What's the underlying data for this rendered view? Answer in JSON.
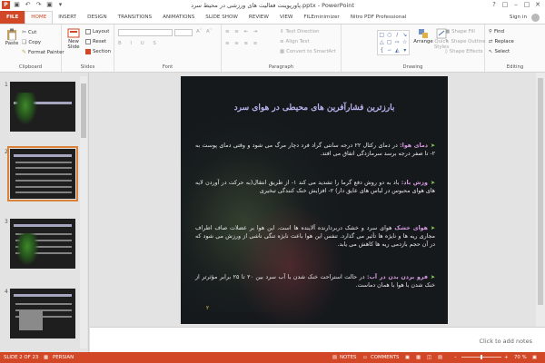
{
  "window": {
    "title": "پاورپوینت فعالیت های ورزشی در محیط سرد.pptx - PowerPoint",
    "sign_in": "Sign in"
  },
  "tabs": [
    {
      "label": "FILE"
    },
    {
      "label": "HOME"
    },
    {
      "label": "INSERT"
    },
    {
      "label": "DESIGN"
    },
    {
      "label": "TRANSITIONS"
    },
    {
      "label": "ANIMATIONS"
    },
    {
      "label": "SLIDE SHOW"
    },
    {
      "label": "REVIEW"
    },
    {
      "label": "VIEW"
    },
    {
      "label": "FILEminimizer"
    },
    {
      "label": "Nitro PDF Professional"
    }
  ],
  "ribbon": {
    "clipboard": {
      "label": "Clipboard",
      "paste": "Paste",
      "cut": "Cut",
      "copy": "Copy",
      "format_painter": "Format Painter"
    },
    "slides": {
      "label": "Slides",
      "new_slide": "New Slide",
      "layout": "Layout",
      "reset": "Reset",
      "section": "Section"
    },
    "font": {
      "label": "Font"
    },
    "paragraph": {
      "label": "Paragraph",
      "text_direction": "Text Direction",
      "align_text": "Align Text",
      "convert_smartart": "Convert to SmartArt"
    },
    "drawing": {
      "label": "Drawing",
      "arrange": "Arrange",
      "quick_styles": "Quick Styles",
      "shape_fill": "Shape Fill",
      "shape_outline": "Shape Outline",
      "shape_effects": "Shape Effects"
    },
    "editing": {
      "label": "Editing",
      "find": "Find",
      "replace": "Replace",
      "select": "Select"
    }
  },
  "thumbnails": [
    {
      "num": "1"
    },
    {
      "num": "2"
    },
    {
      "num": "3"
    },
    {
      "num": "4"
    }
  ],
  "slide": {
    "title": "بارزترین فشارآفرین های محیطی در هوای سرد",
    "paragraphs": [
      {
        "key": "دمای هوا:",
        "text": " در دمای رکتال ۲۲ درجه سانتی گراد فرد دچار مرگ می شود و وقتی دمای پوست به ۲- تا صفر درجه برسد سرمازدگی اتفاق می افتد."
      },
      {
        "key": "وزش باد:",
        "text": " باد به دو روش دفع گرما را تشدید می کند ۱- از طریق انتقال(به حرکت در آوردن لایه های هوای محبوس در لباس های عایق دار) ۲- افزایش خنک کنندگی تبخیری"
      },
      {
        "key": "هوای خشک",
        "text": " هوای سرد و خشک دربردارنده آلاینده ها است. این هوا بر عضلات صاف اطراف مجاری ریه ها و نایژه ها تأثیر می گذارد. تنفس این هوا باعث نایژه تنگی ناشی از ورزش می شود که در آن حجم بازدمی ریه ها کاهش می یابد."
      },
      {
        "key": "فرو بردن بدن در آب:",
        "text": " در حالت استراحت خنک شدن با آب سرد بین ۲۰ تا ۲۵ برابر مؤثرتر از خنک شدن با هوا با همان دماست."
      }
    ],
    "number": "۲"
  },
  "notes": {
    "placeholder": "Click to add notes"
  },
  "status": {
    "slide_info": "SLIDE 2 OF 23",
    "language": "PERSIAN",
    "notes": "NOTES",
    "comments": "COMMENTS",
    "zoom": "70 %",
    "zoom_level": 0.5
  }
}
